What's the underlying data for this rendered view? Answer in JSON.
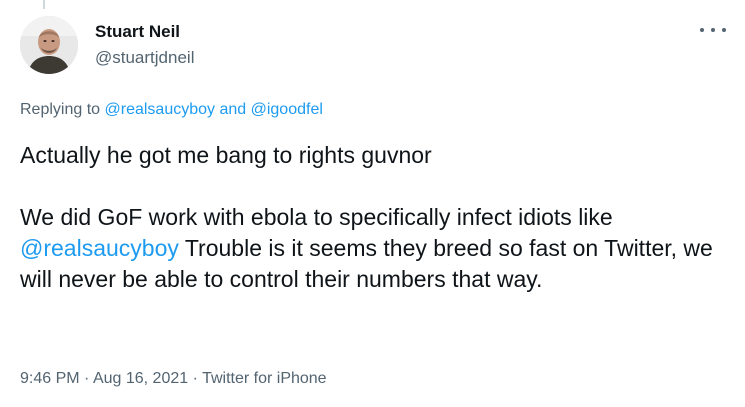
{
  "author": {
    "display_name": "Stuart Neil",
    "handle": "@stuartjdneil"
  },
  "icons": {
    "more": "more-options-icon",
    "avatar": "profile-avatar"
  },
  "reply": {
    "prefix": "Replying to ",
    "user1": "@realsaucyboy",
    "joiner": " and ",
    "user2": "@igoodfel"
  },
  "body": {
    "para1": "Actually he got me bang to rights guvnor",
    "para2_before": "We did GoF work with ebola to specifically infect idiots like ",
    "para2_mention": "@realsaucyboy",
    "para2_after": " Trouble is it seems they breed so fast on Twitter, we will never be able to control their numbers that way."
  },
  "meta": {
    "time": "9:46 PM",
    "separator1": " · ",
    "date": "Aug 16, 2021",
    "separator2": " · ",
    "source": "Twitter for iPhone"
  },
  "colors": {
    "link": "#1d9bf0",
    "secondary_text": "#536471",
    "primary_text": "#0f1419"
  }
}
